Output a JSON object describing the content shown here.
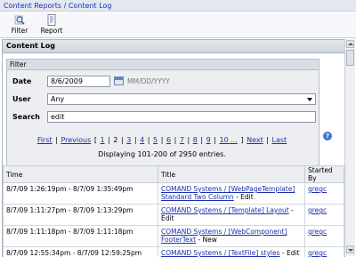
{
  "breadcrumb": {
    "part1": "Content Reports",
    "separator": " / ",
    "part2": "Content Log"
  },
  "toolbar": {
    "filter_label": "Filter",
    "report_label": "Report"
  },
  "panel": {
    "title": "Content Log"
  },
  "filter": {
    "title": "Filter",
    "date_label": "Date",
    "date_value": "8/6/2009",
    "date_hint": "MM/DD/YYYY",
    "user_label": "User",
    "user_value": "Any",
    "search_label": "Search",
    "search_value": "edit"
  },
  "pager": {
    "first": "First",
    "previous": "Previous",
    "open_bracket": "[",
    "pages": [
      "1",
      "2",
      "3",
      "4",
      "5",
      "6",
      "7",
      "8",
      "9",
      "10 ..."
    ],
    "close_bracket": "]",
    "next": "Next",
    "last": "Last",
    "current_page": "2"
  },
  "displaying": "Displaying 101-200 of 2950 entries.",
  "table": {
    "headers": [
      "Time",
      "Title",
      "Started By"
    ],
    "rows": [
      {
        "time": "8/7/09 1:26:19pm - 8/7/09 1:35:49pm",
        "title_link": "COMAND Systems / [WebPageTemplate] Standard Two Column",
        "action": " - Edit",
        "user": "gregc"
      },
      {
        "time": "8/7/09 1:11:27pm - 8/7/09 1:13:29pm",
        "title_link": "COMAND Systems / [Template] Layout",
        "action": " - Edit",
        "user": "gregc"
      },
      {
        "time": "8/7/09 1:11:18pm - 8/7/09 1:11:18pm",
        "title_link": "COMAND Systems / [WebComponent] FooterText",
        "action": " - New",
        "user": "gregc"
      },
      {
        "time": "8/7/09 12:55:34pm - 8/7/09 12:59:25pm",
        "title_link": "COMAND Systems / [TextFile] styles",
        "action": " - Edit",
        "user": "gregc"
      }
    ]
  }
}
